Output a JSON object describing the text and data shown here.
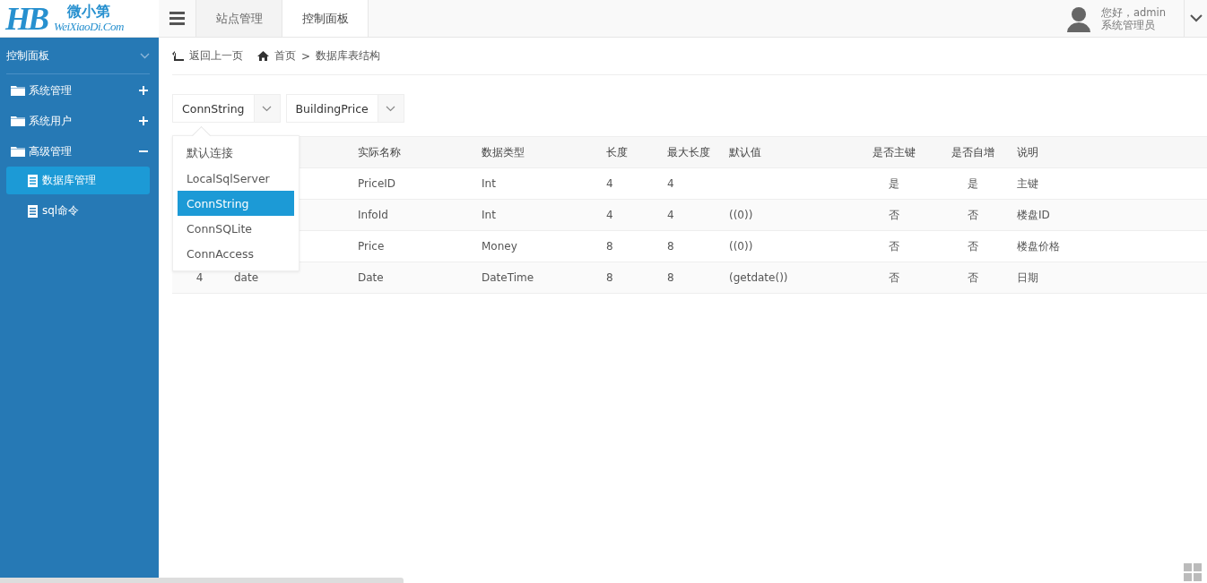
{
  "logo": {
    "mark": "HB",
    "name": "微小第",
    "domain": "WeiXiaoDi.Com"
  },
  "top_tabs": [
    {
      "label": "站点管理",
      "selected": false
    },
    {
      "label": "控制面板",
      "selected": true
    }
  ],
  "user": {
    "greeting": "您好，admin",
    "role": "系统管理员"
  },
  "sidebar": {
    "title": "控制面板",
    "groups": [
      {
        "label": "系统管理",
        "expanded": false
      },
      {
        "label": "系统用户",
        "expanded": false
      },
      {
        "label": "高级管理",
        "expanded": true,
        "children": [
          {
            "label": "数据库管理",
            "selected": true
          },
          {
            "label": "sql命令",
            "selected": false
          }
        ]
      }
    ]
  },
  "breadcrumb": {
    "back": "返回上一页",
    "home": "首页",
    "separator": ">",
    "current": "数据库表结构"
  },
  "selects": [
    {
      "value": "ConnString",
      "options": [
        {
          "label": "默认连接",
          "selected": false
        },
        {
          "label": "LocalSqlServer",
          "selected": false
        },
        {
          "label": "ConnString",
          "selected": true
        },
        {
          "label": "ConnSQLite",
          "selected": false
        },
        {
          "label": "ConnAccess",
          "selected": false
        }
      ]
    },
    {
      "value": "BuildingPrice"
    }
  ],
  "table": {
    "columns": [
      "实际名称",
      "数据类型",
      "长度",
      "最大长度",
      "默认值",
      "是否主键",
      "是否自增",
      "说明"
    ],
    "rows": [
      {
        "cells": [
          "PriceID",
          "Int",
          "4",
          "4",
          "",
          "是",
          "是",
          "主键"
        ]
      },
      {
        "cells": [
          "InfoId",
          "Int",
          "4",
          "4",
          "((0))",
          "否",
          "否",
          "楼盘ID"
        ]
      },
      {
        "cells": [
          "Price",
          "Money",
          "8",
          "8",
          "((0))",
          "否",
          "否",
          "楼盘价格"
        ]
      },
      {
        "number": "4",
        "name": "date",
        "cells": [
          "Date",
          "DateTime",
          "8",
          "8",
          "(getdate())",
          "否",
          "否",
          "日期"
        ]
      }
    ]
  }
}
